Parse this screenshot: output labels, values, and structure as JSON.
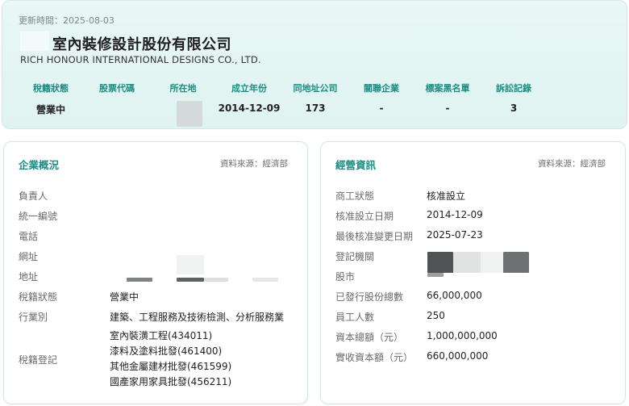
{
  "header": {
    "updated": "更新時間：2025-08-03",
    "company_cn": "室內裝修設計股份有限公司",
    "company_en": "RICH HONOUR INTERNATIONAL DESIGNS CO., LTD.",
    "stats": [
      {
        "label": "稅籍狀態",
        "value": "營業中"
      },
      {
        "label": "股票代碼",
        "value": ""
      },
      {
        "label": "所在地",
        "value": ""
      },
      {
        "label": "成立年份",
        "value": "2014-12-09"
      },
      {
        "label": "同地址公司",
        "value": "173"
      },
      {
        "label": "關聯企業",
        "value": "-"
      },
      {
        "label": "標案黑名單",
        "value": "-"
      },
      {
        "label": "訴訟記錄",
        "value": "3"
      }
    ]
  },
  "overview": {
    "title": "企業概況",
    "source": "資料來源：經濟部",
    "rows": [
      {
        "key": "負責人",
        "value": ""
      },
      {
        "key": "統一編號",
        "value": ""
      },
      {
        "key": "電話",
        "value": ""
      },
      {
        "key": "網址",
        "value": ""
      },
      {
        "key": "地址",
        "value": ""
      },
      {
        "key": "稅籍狀態",
        "value": "營業中"
      },
      {
        "key": "行業別",
        "value": "建築、工程服務及技術檢測、分析服務業"
      },
      {
        "key": "稅籍登記",
        "value": ""
      }
    ],
    "tax_items": [
      "室內裝潢工程(434011)",
      "漆料及塗料批發(461400)",
      "其他金屬建材批發(461599)",
      "國產家用家具批發(456211)"
    ]
  },
  "business": {
    "title": "經營資訊",
    "source": "資料來源：經濟部",
    "rows": [
      {
        "key": "商工狀態",
        "value": "核准設立"
      },
      {
        "key": "核准設立日期",
        "value": "2014-12-09"
      },
      {
        "key": "最後核准變更日期",
        "value": "2025-07-23"
      },
      {
        "key": "登記機關",
        "value": ""
      },
      {
        "key": "股市",
        "value": ""
      },
      {
        "key": "已發行股份總數",
        "value": "66,000,000"
      },
      {
        "key": "員工人數",
        "value": "250"
      },
      {
        "key": "資本總額（元）",
        "value": "1,000,000,000"
      },
      {
        "key": "實收資本額（元）",
        "value": "660,000,000"
      }
    ]
  }
}
